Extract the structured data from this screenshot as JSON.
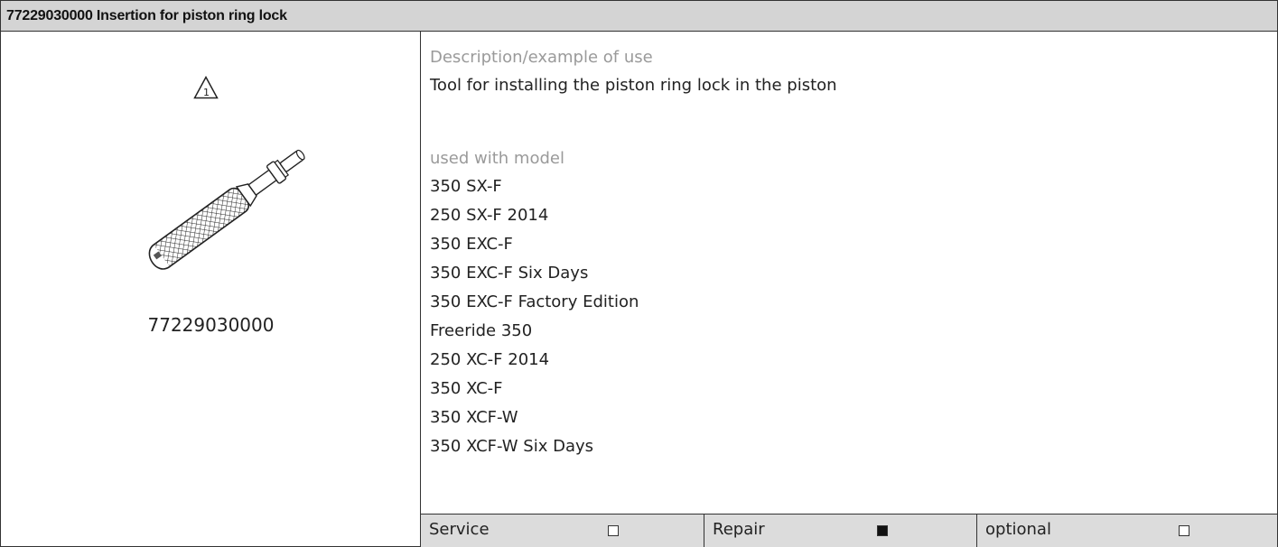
{
  "header": {
    "title": "77229030000 Insertion for piston ring lock"
  },
  "figure": {
    "warning_number": "1",
    "part_number": "77229030000"
  },
  "description": {
    "label": "Description/example of use",
    "text": "Tool for installing the piston ring lock in the piston"
  },
  "models": {
    "label": "used with model",
    "items": [
      "350 SX-F",
      "250 SX-F 2014",
      "350 EXC-F",
      "350 EXC-F Six Days",
      "350 EXC-F Factory Edition",
      "Freeride 350",
      "250 XC-F 2014",
      "350 XC-F",
      "350 XCF-W",
      "350 XCF-W Six Days"
    ]
  },
  "footer": [
    {
      "label": "Service",
      "checked": false
    },
    {
      "label": "Repair",
      "checked": true
    },
    {
      "label": "optional",
      "checked": false
    }
  ]
}
